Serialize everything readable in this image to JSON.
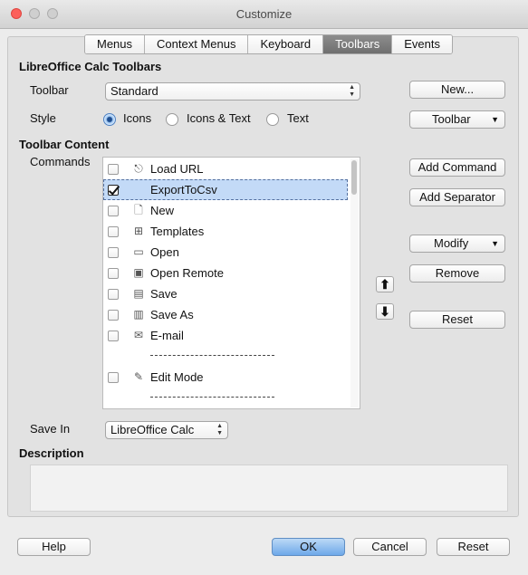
{
  "window": {
    "title": "Customize"
  },
  "tabs": [
    {
      "label": "Menus"
    },
    {
      "label": "Context Menus"
    },
    {
      "label": "Keyboard"
    },
    {
      "label": "Toolbars",
      "active": true
    },
    {
      "label": "Events"
    }
  ],
  "section_title": "LibreOffice Calc Toolbars",
  "toolbar": {
    "label": "Toolbar",
    "value": "Standard",
    "new_button": "New...",
    "menu_button": "Toolbar"
  },
  "style": {
    "label": "Style",
    "options": [
      "Icons",
      "Icons & Text",
      "Text"
    ],
    "selected": "Icons"
  },
  "content": {
    "title": "Toolbar Content",
    "commands_label": "Commands",
    "items": [
      {
        "label": "Load URL",
        "checked": false,
        "icon": "load-url-icon"
      },
      {
        "label": "ExportToCsv",
        "checked": true,
        "icon": "",
        "selected": true
      },
      {
        "label": "New",
        "checked": false,
        "icon": "new-document-icon"
      },
      {
        "label": "Templates",
        "checked": false,
        "icon": "templates-icon"
      },
      {
        "label": "Open",
        "checked": false,
        "icon": "open-folder-icon"
      },
      {
        "label": "Open Remote",
        "checked": false,
        "icon": "open-remote-icon"
      },
      {
        "label": "Save",
        "checked": false,
        "icon": "save-icon"
      },
      {
        "label": "Save As",
        "checked": false,
        "icon": "save-as-icon"
      },
      {
        "label": "E-mail",
        "checked": false,
        "icon": "email-icon"
      },
      {
        "separator": true
      },
      {
        "label": "Edit Mode",
        "checked": false,
        "icon": "edit-mode-icon"
      },
      {
        "separator": true
      }
    ],
    "buttons": {
      "add_command": "Add Command",
      "add_separator": "Add Separator",
      "modify": "Modify",
      "remove": "Remove",
      "reset": "Reset"
    }
  },
  "save_in": {
    "label": "Save In",
    "value": "LibreOffice Calc"
  },
  "description": {
    "label": "Description"
  },
  "footer": {
    "help": "Help",
    "ok": "OK",
    "cancel": "Cancel",
    "reset": "Reset"
  }
}
